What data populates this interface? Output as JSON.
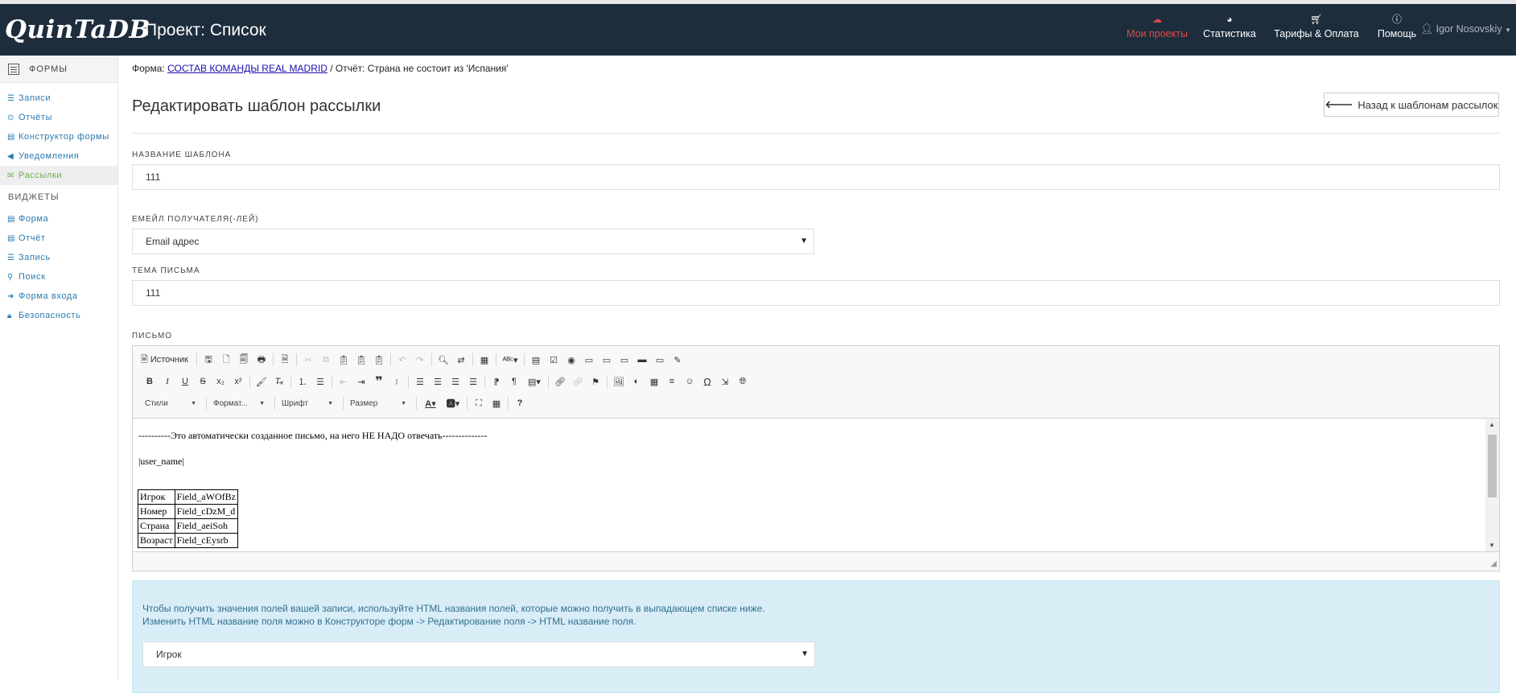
{
  "app": {
    "logo": "QuinTaDB",
    "project_title": "Проект: Список"
  },
  "nav": {
    "items": [
      {
        "label": "Мои проекты",
        "icon": "cloud-icon"
      },
      {
        "label": "Статистика",
        "icon": "pie-chart-icon"
      },
      {
        "label": "Тарифы & Оплата",
        "icon": "cart-icon"
      },
      {
        "label": "Помощь",
        "icon": "info-icon"
      }
    ],
    "user": "Igor Nosovskiy",
    "active_color": "#e04a4a",
    "bg_color": "#1d2d3c"
  },
  "sidebar": {
    "forms_header": "ФОРМЫ",
    "forms_items": [
      {
        "label": "Записи",
        "icon": "list-icon"
      },
      {
        "label": "Отчёты",
        "icon": "report-icon"
      },
      {
        "label": "Конструктор формы",
        "icon": "form-builder-icon"
      },
      {
        "label": "Уведомления",
        "icon": "megaphone-icon"
      },
      {
        "label": "Рассылки",
        "icon": "envelope-icon",
        "active": true
      }
    ],
    "widgets_header": "ВИДЖЕТЫ",
    "widgets_items": [
      {
        "label": "Форма",
        "icon": "form-icon"
      },
      {
        "label": "Отчёт",
        "icon": "report-icon"
      },
      {
        "label": "Запись",
        "icon": "record-icon"
      },
      {
        "label": "Поиск",
        "icon": "search-icon"
      },
      {
        "label": "Форма входа",
        "icon": "sign-in-icon"
      },
      {
        "label": "Безопасность",
        "icon": "lock-icon"
      }
    ]
  },
  "breadcrumb": {
    "prefix": "Форма:",
    "form_link": "СОСТАВ КОМАНДЫ REAL MADRID",
    "suffix": " / Отчёт: Страна не состоит из 'Испания'"
  },
  "page": {
    "title": "Редактировать шаблон рассылки",
    "back_button": "Назад к шаблонам рассылок"
  },
  "fields": {
    "template_name_label": "НАЗВАНИЕ ШАБЛОНА",
    "template_name_value": "111",
    "recipient_label": "ЕМЕЙЛ ПОЛУЧАТЕЛЯ(-ЛЕЙ)",
    "recipient_value": "Email адрес",
    "subject_label": "ТЕМА ПИСЬМА",
    "subject_value": "111",
    "letter_label": "ПИСЬМО"
  },
  "editor": {
    "source_label": "Источник",
    "combos": [
      "Стили",
      "Формат...",
      "Шрифт",
      "Размер"
    ],
    "content": {
      "line1": "----------Это автоматически созданное письмо, на него НЕ НАДО отвечать--------------",
      "line2": "|user_name|",
      "table": [
        [
          "Игрок",
          "Field_aWOfBz"
        ],
        [
          "Номер",
          "Field_cDzM_d"
        ],
        [
          "Страна",
          "Field_aeiSoh"
        ],
        [
          "Возраст",
          "Field_cEysrb"
        ]
      ]
    }
  },
  "info": {
    "line1": "Чтобы получить значения полей вашей записи, используйте HTML названия полей, которые можно получить в выпадающем списке ниже.",
    "line2": "Изменить HTML название поля можно в Конструкторе форм -> Редактирование поля -> HTML название поля.",
    "select_value": "Игрок"
  }
}
